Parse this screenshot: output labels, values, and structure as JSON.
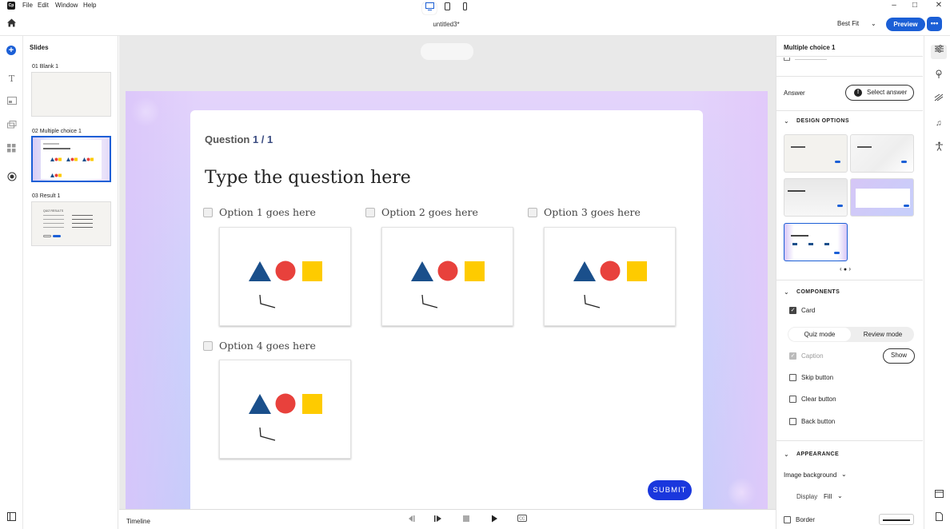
{
  "app": {
    "logo_text": "Cp",
    "menu": [
      "File",
      "Edit",
      "Window",
      "Help"
    ],
    "document_title": "untitled3*",
    "zoom": "Best Fit",
    "preview_label": "Preview",
    "more_label": "•••"
  },
  "slides_panel": {
    "title": "Slides",
    "slides": [
      {
        "label": "01  Blank 1"
      },
      {
        "label": "02  Multiple choice 1"
      },
      {
        "label": "03  Result 1"
      }
    ],
    "thumb3_title": "QUIZ RESULTS"
  },
  "canvas": {
    "question_label": "Question",
    "question_number": "1 / 1",
    "question_text": "Type the question here",
    "options": [
      {
        "label": "Option  1 goes here"
      },
      {
        "label": "Option  2 goes here"
      },
      {
        "label": "Option  3 goes here"
      },
      {
        "label": "Option  4 goes here"
      }
    ],
    "submit_label": "SUBMIT",
    "shape_colors": {
      "triangle": "#1a4f8b",
      "circle": "#e8413c",
      "square": "#fecb00"
    }
  },
  "bottom_bar": {
    "timeline_label": "Timeline"
  },
  "right_panel": {
    "title": "Multiple choice 1",
    "answer_label": "Answer",
    "select_answer_label": "Select answer",
    "design_options_label": "DESIGN OPTIONS",
    "components_label": "COMPONENTS",
    "card_label": "Card",
    "quiz_mode_label": "Quiz mode",
    "review_mode_label": "Review mode",
    "caption_label": "Caption",
    "show_label": "Show",
    "skip_label": "Skip button",
    "clear_label": "Clear button",
    "back_label": "Back button",
    "appearance_label": "APPEARANCE",
    "image_bg_label": "Image background",
    "display_label": "Display",
    "display_value": "Fill",
    "border_label": "Border"
  },
  "colors": {
    "accent": "#1b5fd6",
    "submit": "#1a37dd"
  }
}
